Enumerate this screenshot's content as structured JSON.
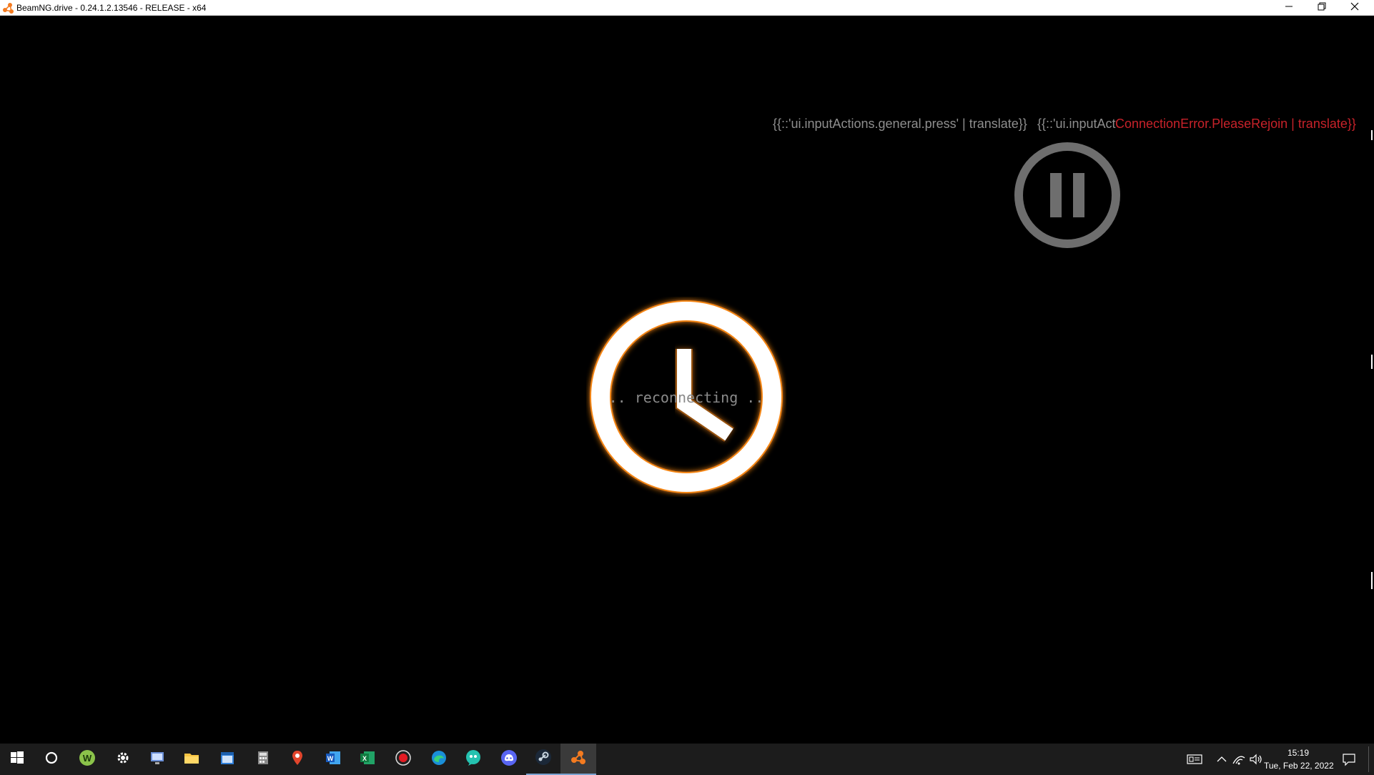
{
  "window": {
    "title": "BeamNG.drive - 0.24.1.2.13546 - RELEASE - x64",
    "app_icon": "beamng-logo-icon",
    "controls": [
      "minimize-icon",
      "restore-icon",
      "close-icon"
    ]
  },
  "game": {
    "hint_press": "{{::'ui.inputActions.general.press' | translate}}",
    "hint_second": "{{::'ui.inputAct",
    "error_text": "ConnectionError.PleaseRejoin | translate}}",
    "pause_icon": "pause-circle-icon",
    "loading_icon": "clock-icon",
    "reconnecting_text": ".. reconnecting ..",
    "colors": {
      "background": "#000000",
      "hint": "#8e8e8e",
      "error": "#c8222a",
      "clock_glow": "#ff8c1a"
    }
  },
  "taskbar": {
    "apps": [
      {
        "name": "start-icon"
      },
      {
        "name": "cortana-icon"
      },
      {
        "name": "w-app-icon"
      },
      {
        "name": "settings-icon"
      },
      {
        "name": "remote-desktop-icon"
      },
      {
        "name": "file-explorer-icon"
      },
      {
        "name": "calendar-icon"
      },
      {
        "name": "calculator-icon"
      },
      {
        "name": "maps-icon"
      },
      {
        "name": "word-icon"
      },
      {
        "name": "excel-icon"
      },
      {
        "name": "record-icon"
      },
      {
        "name": "edge-icon"
      },
      {
        "name": "messenger-icon"
      },
      {
        "name": "discord-icon"
      },
      {
        "name": "steam-icon"
      },
      {
        "name": "beamng-icon"
      }
    ],
    "tray": [
      "keyboard-icon",
      "chevron-up-icon",
      "network-icon",
      "volume-icon"
    ],
    "time": "15:19",
    "date": "Tue, Feb 22, 2022",
    "notification_icon": "notification-icon"
  }
}
